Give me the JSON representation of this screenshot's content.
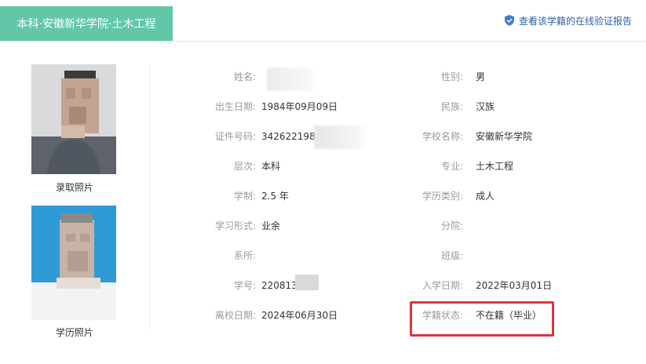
{
  "header": {
    "tab_title": "本科·安徽新华学院·土木工程",
    "verify_link": "查看该学籍的在线验证报告"
  },
  "photos": {
    "admission_caption": "录取照片",
    "graduation_caption": "学历照片"
  },
  "fields": {
    "name_label": "姓名:",
    "name_value": "",
    "gender_label": "性别:",
    "gender_value": "男",
    "birth_label": "出生日期:",
    "birth_value": "1984年09月09日",
    "ethnicity_label": "民族:",
    "ethnicity_value": "汉族",
    "id_label": "证件号码:",
    "id_value": "3426221984",
    "school_label": "学校名称:",
    "school_value": "安徽新华学院",
    "level_label": "层次:",
    "level_value": "本科",
    "major_label": "专业:",
    "major_value": "土木工程",
    "duration_label": "学制:",
    "duration_value": "2.5 年",
    "edu_type_label": "学历类别:",
    "edu_type_value": "成人",
    "study_form_label": "学习形式:",
    "study_form_value": "业余",
    "branch_label": "分院:",
    "branch_value": "",
    "department_label": "系所:",
    "department_value": "",
    "class_label": "班级:",
    "class_value": "",
    "student_no_label": "学号:",
    "student_no_value": "220813",
    "enroll_label": "入学日期:",
    "enroll_value": "2022年03月01日",
    "leave_label": "离校日期:",
    "leave_value": "2024年06月30日",
    "status_label": "学籍状态:",
    "status_value": "不在籍（毕业）"
  },
  "colors": {
    "tab_bg": "#62c7a8",
    "link": "#2f5fa8",
    "highlight": "#d9363e",
    "label": "#9a9a9a"
  }
}
